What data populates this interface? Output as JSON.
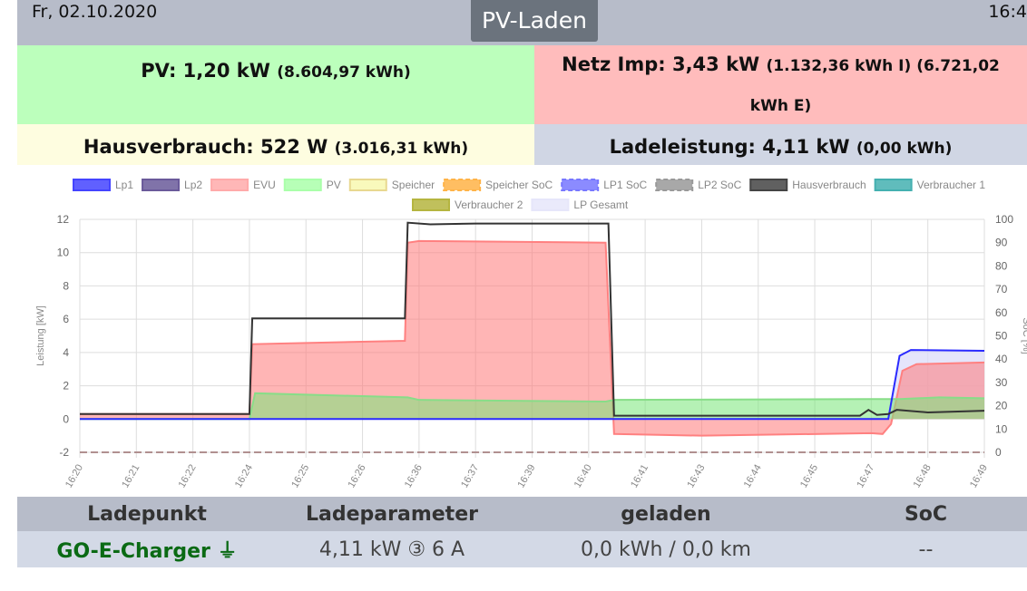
{
  "header": {
    "date": "Fr, 02.10.2020",
    "mode": "PV-Laden",
    "time": "16:4"
  },
  "summary": {
    "pv": {
      "label": "PV: 1,20 kW",
      "sub": "(8.604,97 kWh)"
    },
    "netz": {
      "label": "Netz Imp: 3,43 kW",
      "sub1": "(1.132,36 kWh I) (6.721,02",
      "sub2": "kWh E)"
    },
    "haus": {
      "label": "Hausverbrauch: 522 W",
      "sub": "(3.016,31 kWh)"
    },
    "lade": {
      "label": "Ladeleistung: 4,11 kW",
      "sub": "(0,00 kWh)"
    }
  },
  "chart_data": {
    "type": "line",
    "ylabel": "Leistung [kW]",
    "y2label": "SoC [%]",
    "ylim": [
      -2,
      12
    ],
    "y2lim": [
      0,
      100
    ],
    "yticks": [
      12,
      10,
      8,
      6,
      4,
      2,
      0,
      -2
    ],
    "y2ticks": [
      100,
      90,
      80,
      70,
      60,
      50,
      40,
      30,
      20,
      10,
      0
    ],
    "categories": [
      "16:20",
      "16:21",
      "16:22",
      "16:24",
      "16:25",
      "16:26",
      "16:36",
      "16:37",
      "16:39",
      "16:40",
      "16:41",
      "16:43",
      "16:44",
      "16:45",
      "16:47",
      "16:48",
      "16:49"
    ],
    "legend": [
      {
        "name": "Lp1",
        "color": "#4444ff",
        "dash": false
      },
      {
        "name": "Lp2",
        "color": "#6a5a9a",
        "dash": false
      },
      {
        "name": "EVU",
        "color": "#ffaaaa",
        "dash": false
      },
      {
        "name": "PV",
        "color": "#aaffaa",
        "dash": false
      },
      {
        "name": "Speicher",
        "color": "#f8f8b0",
        "dash": false
      },
      {
        "name": "Speicher SoC",
        "color": "#ffb347",
        "dash": true
      },
      {
        "name": "LP1 SoC",
        "color": "#7777ff",
        "dash": true
      },
      {
        "name": "LP2 SoC",
        "color": "#999999",
        "dash": true
      },
      {
        "name": "Hausverbrauch",
        "color": "#444444",
        "dash": false
      },
      {
        "name": "Verbraucher 1",
        "color": "#44b0b0",
        "dash": false
      },
      {
        "name": "Verbraucher 2",
        "color": "#b5b540",
        "dash": false
      },
      {
        "name": "LP Gesamt",
        "color": "#e6e6fa",
        "dash": false
      }
    ],
    "series": [
      {
        "name": "LP Gesamt",
        "fill": "rgba(220,220,250,0.75)",
        "stroke": "none",
        "points": [
          [
            0,
            0
          ],
          [
            14.3,
            0
          ],
          [
            14.5,
            3.8
          ],
          [
            14.7,
            4.15
          ],
          [
            16,
            4.1
          ]
        ]
      },
      {
        "name": "EVU",
        "fill": "rgba(255,120,120,0.55)",
        "stroke": "#ff8080",
        "points": [
          [
            0,
            0.3
          ],
          [
            3,
            0.3
          ],
          [
            3.05,
            4.5
          ],
          [
            5.75,
            4.7
          ],
          [
            5.8,
            10.6
          ],
          [
            6,
            10.7
          ],
          [
            9.3,
            10.6
          ],
          [
            9.45,
            -0.9
          ],
          [
            11,
            -1.0
          ],
          [
            14,
            -0.85
          ],
          [
            14.2,
            -0.9
          ],
          [
            14.35,
            -0.3
          ],
          [
            14.55,
            2.9
          ],
          [
            14.8,
            3.3
          ],
          [
            16,
            3.4
          ]
        ]
      },
      {
        "name": "PV",
        "fill": "rgba(120,230,120,0.55)",
        "stroke": "#88dd88",
        "points": [
          [
            0,
            0
          ],
          [
            3,
            0
          ],
          [
            3.1,
            1.55
          ],
          [
            5.8,
            1.3
          ],
          [
            6,
            1.15
          ],
          [
            9.3,
            1.05
          ],
          [
            9.45,
            1.15
          ],
          [
            14,
            1.2
          ],
          [
            14.5,
            1.2
          ],
          [
            15.2,
            1.3
          ],
          [
            16,
            1.25
          ]
        ]
      },
      {
        "name": "Lp1",
        "fill": "none",
        "stroke": "#2a2aff",
        "points": [
          [
            0,
            0
          ],
          [
            14.3,
            0
          ],
          [
            14.5,
            3.8
          ],
          [
            14.7,
            4.15
          ],
          [
            16,
            4.1
          ]
        ]
      },
      {
        "name": "Hausverbrauch",
        "fill": "none",
        "stroke": "#333333",
        "points": [
          [
            0,
            0.3
          ],
          [
            3,
            0.3
          ],
          [
            3.05,
            6.05
          ],
          [
            5.75,
            6.05
          ],
          [
            5.8,
            11.8
          ],
          [
            6.2,
            11.7
          ],
          [
            7,
            11.75
          ],
          [
            9.35,
            11.75
          ],
          [
            9.45,
            0.2
          ],
          [
            12,
            0.2
          ],
          [
            13.8,
            0.2
          ],
          [
            13.95,
            0.55
          ],
          [
            14.1,
            0.25
          ],
          [
            14.3,
            0.3
          ],
          [
            14.45,
            0.55
          ],
          [
            15,
            0.4
          ],
          [
            16,
            0.5
          ]
        ]
      }
    ],
    "soc_line": {
      "value": 0,
      "color": "#b09090"
    }
  },
  "table": {
    "headers": [
      "Ladepunkt",
      "Ladeparameter",
      "geladen",
      "SoC"
    ],
    "rows": [
      {
        "name": "GO-E-Charger",
        "params": "4,11 kW ③ 6 A",
        "charged": "0,0 kWh / 0,0 km",
        "soc": "--"
      }
    ]
  }
}
